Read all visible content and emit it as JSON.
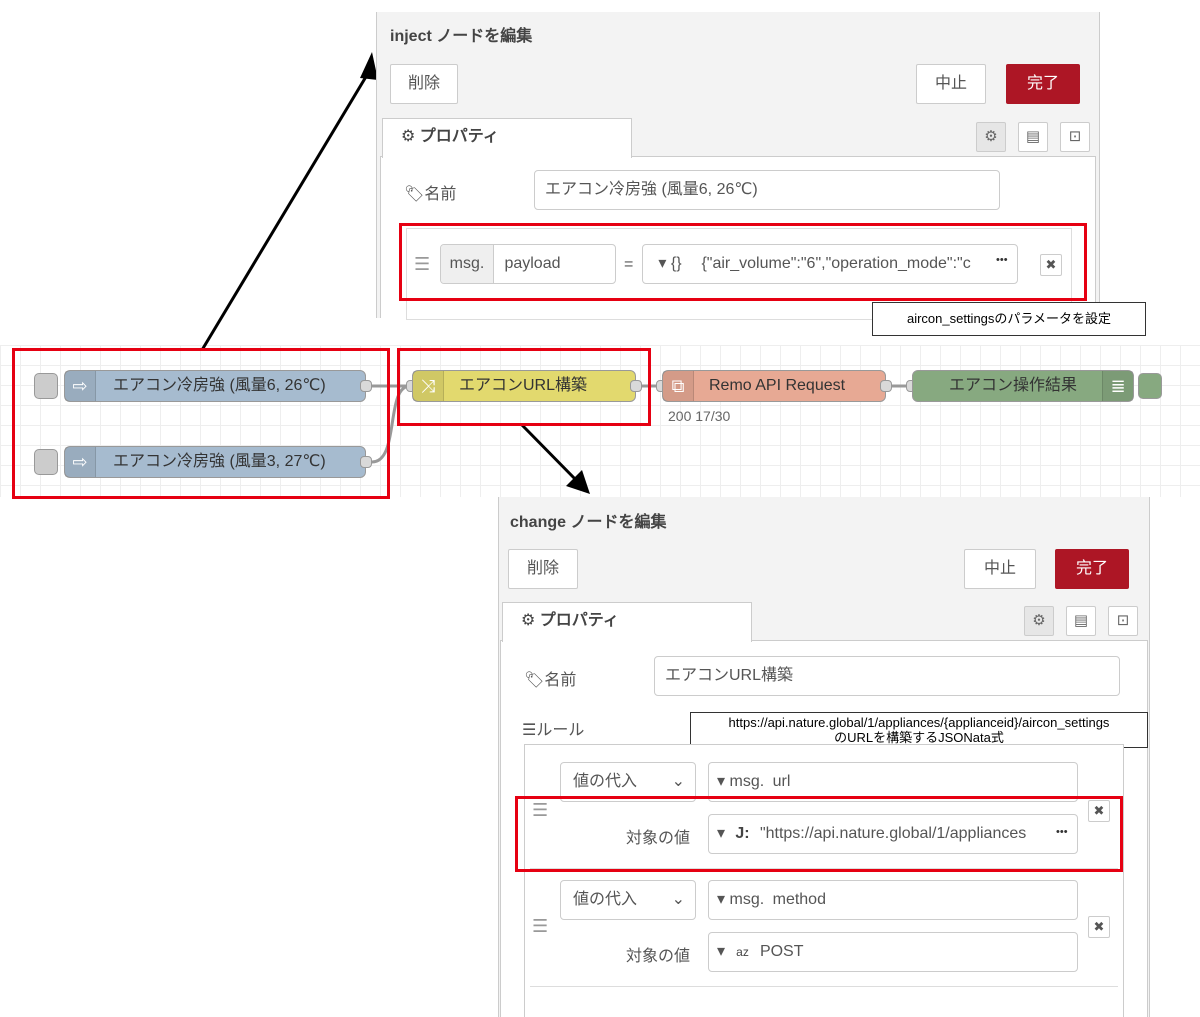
{
  "flow": {
    "inject1_label": "エアコン冷房強 (風量6, 26℃)",
    "inject2_label": "エアコン冷房強 (風量3, 27℃)",
    "change_label": "エアコンURL構築",
    "http_label": "Remo API Request",
    "http_status": "200 17/30",
    "debug_label": "エアコン操作結果",
    "colors": {
      "inject": "#a6bbcf",
      "change": "#e2d96e",
      "http": "#e7a994",
      "debug": "#87a980"
    }
  },
  "inject_panel": {
    "title": "inject ノードを編集",
    "delete_label": "削除",
    "cancel_label": "中止",
    "done_label": "完了",
    "tab_label": "プロパティ",
    "name_label": "名前",
    "name_value": "エアコン冷房強 (風量6, 26℃)",
    "prop_prefix": "msg.",
    "prop_value": "payload",
    "equals": "=",
    "type_symbol": "{}",
    "type_value": "{\"air_volume\":\"6\",\"operation_mode\":\"c",
    "more": "•••",
    "remove": "✖"
  },
  "tooltip1": "aircon_settingsのパラメータを設定",
  "change_panel": {
    "title": "change ノードを編集",
    "delete_label": "削除",
    "cancel_label": "中止",
    "done_label": "完了",
    "tab_label": "プロパティ",
    "name_label": "名前",
    "name_value": "エアコンURL構築",
    "rules_label": "ルール",
    "rule1_action": "値の代入",
    "rule1_prefix": "msg.",
    "rule1_prop": "url",
    "rule1_target_label": "対象の値",
    "rule1_type_symbol": "J:",
    "rule1_value": "\"https://api.nature.global/1/appliances",
    "rule2_action": "値の代入",
    "rule2_prefix": "msg.",
    "rule2_prop": "method",
    "rule2_target_label": "対象の値",
    "rule2_type_symbol": "az",
    "rule2_value": "POST",
    "more": "•••",
    "remove": "✖"
  },
  "tooltip2": {
    "line1": "https://api.nature.global/1/appliances/{applianceid}/aircon_settings",
    "line2": "のURLを構築するJSONata式"
  }
}
